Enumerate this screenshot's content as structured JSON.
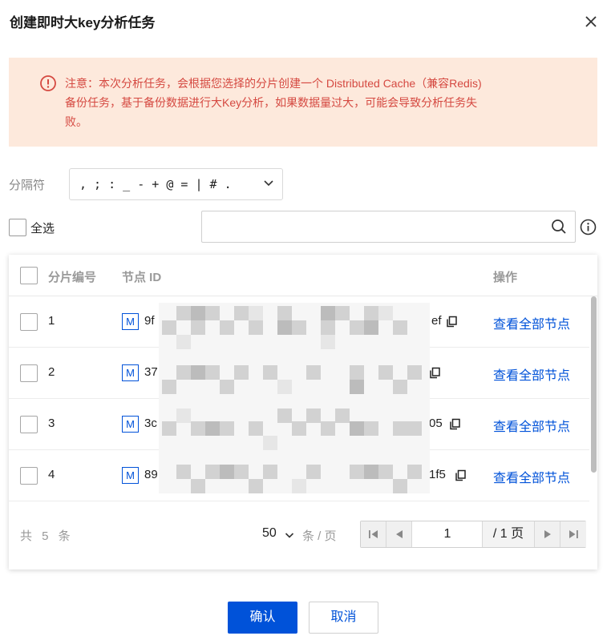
{
  "dialog": {
    "title": "创建即时大key分析任务",
    "close_icon": "close-icon"
  },
  "alert": {
    "icon": "warning-circle-icon",
    "line1": "注意：本次分析任务，会根据您选择的分片创建一个 Distributed Cache（兼容Redis)",
    "line2": "备份任务，基于备份数据进行大Key分析，如果数据量过大，可能会导致分析任务失",
    "line3": "败。",
    "color": "#d54941",
    "background": "#fde9dc"
  },
  "separator": {
    "label": "分隔符",
    "value": ", ; : _ - + @ = | # ."
  },
  "select_all": {
    "label": "全选"
  },
  "search": {
    "placeholder": ""
  },
  "table": {
    "headers": {
      "shard_no": "分片编号",
      "node_id": "节点 ID",
      "action": "操作"
    },
    "rows": [
      {
        "num": "1",
        "badge": "M",
        "node_start": "9f",
        "node_end": "ef",
        "action": "查看全部节点"
      },
      {
        "num": "2",
        "badge": "M",
        "node_start": "37",
        "node_end": "",
        "action": "查看全部节点"
      },
      {
        "num": "3",
        "badge": "M",
        "node_start": "3c",
        "node_end": "05",
        "action": "查看全部节点"
      },
      {
        "num": "4",
        "badge": "M",
        "node_start": "89",
        "node_end": "1f5",
        "action": "查看全部节点"
      }
    ]
  },
  "pagination": {
    "total": "共 5 条",
    "page_size": "50",
    "unit": "条 / 页",
    "current_page": "1",
    "total_pages": "/ 1 页"
  },
  "footer": {
    "confirm": "确认",
    "cancel": "取消"
  },
  "colors": {
    "primary": "#0052d9"
  }
}
